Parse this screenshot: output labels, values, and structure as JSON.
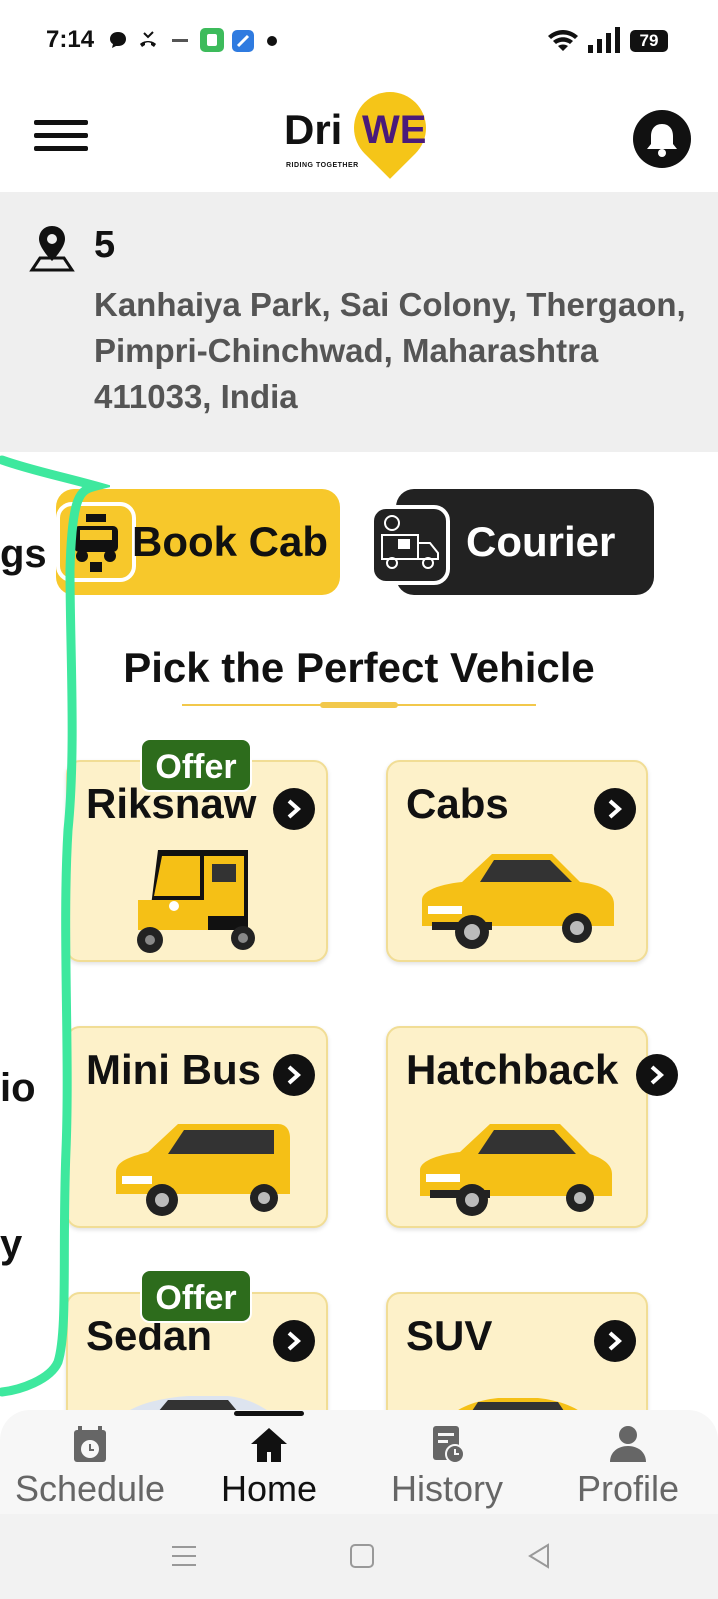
{
  "status_bar": {
    "time": "7:14",
    "battery": "79"
  },
  "header": {
    "logo_dri": "Dri",
    "logo_we": "WE",
    "logo_tagline": "RIDING TOGETHER"
  },
  "address": {
    "number": "5",
    "text": "Kanhaiya Park, Sai Colony, Thergaon, Pimpri-Chinchwad, Maharashtra 411033, India"
  },
  "actions": {
    "book_cab": "Book Cab",
    "courier": "Courier"
  },
  "section": {
    "title": "Pick the Perfect Vehicle"
  },
  "vehicles": [
    {
      "label": "Riksnaw",
      "offer": "Offer"
    },
    {
      "label": "Cabs"
    },
    {
      "label": "Mini Bus"
    },
    {
      "label": "Hatchback"
    },
    {
      "label": "Sedan",
      "offer": "Offer"
    },
    {
      "label": "SUV"
    }
  ],
  "side_fragments": [
    "gs",
    "io",
    "y"
  ],
  "bottom_nav": {
    "items": [
      {
        "label": "Schedule",
        "icon": "calendar-clock-icon",
        "active": false
      },
      {
        "label": "Home",
        "icon": "home-icon",
        "active": true
      },
      {
        "label": "History",
        "icon": "history-icon",
        "active": false
      },
      {
        "label": "Profile",
        "icon": "profile-icon",
        "active": false
      }
    ]
  },
  "colors": {
    "brand_yellow": "#f7c82b",
    "brand_purple": "#4a1a7a",
    "offer_green": "#2d6c1c",
    "card_bg": "#fdf1c9"
  }
}
